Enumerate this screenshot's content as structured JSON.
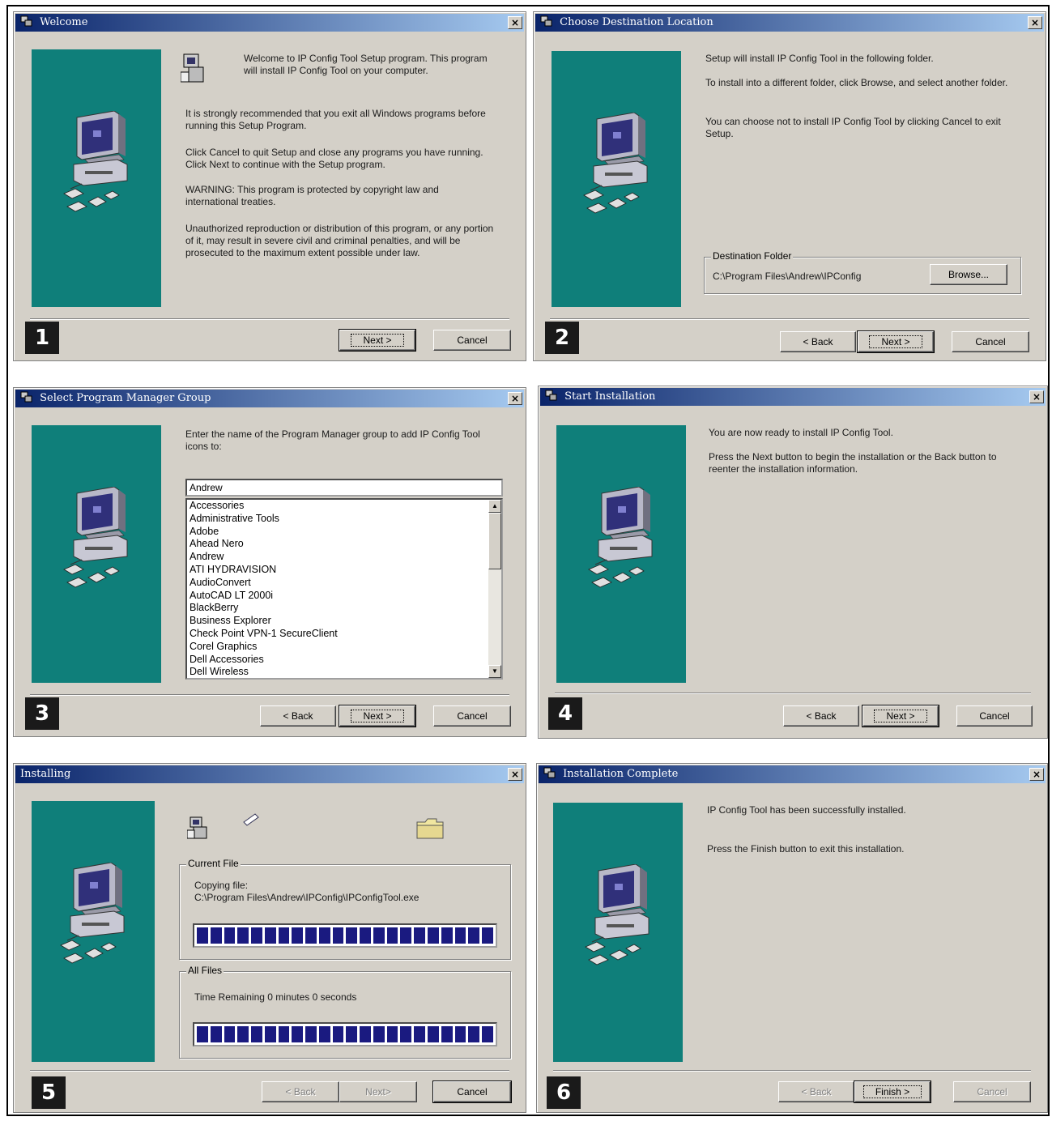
{
  "colors": {
    "teal": "#0f7f7a",
    "title_start": "#0a246a",
    "title_end": "#a6caf0",
    "progress": "#1a1a80",
    "face": "#d4d0c8"
  },
  "icons": {
    "title": "setup-icon",
    "close": "close-icon",
    "panel": "computer-with-disks-icon"
  },
  "d1": {
    "number": "1",
    "title": "Welcome",
    "intro": "Welcome to IP Config Tool Setup program. This program will install IP Config Tool on your computer.",
    "p1": "It is strongly recommended that you exit all Windows programs before running this Setup Program.",
    "p2": "Click Cancel to quit Setup and close any programs you have running. Click Next to continue with the Setup program.",
    "p3": "WARNING: This program is protected by copyright law and international treaties.",
    "p4": "Unauthorized reproduction or distribution of this program, or any portion of it, may result in severe civil and criminal penalties, and will be prosecuted to the maximum extent possible under law.",
    "next": "Next >",
    "cancel": "Cancel"
  },
  "d2": {
    "number": "2",
    "title": "Choose Destination Location",
    "p1": "Setup will install IP Config Tool in the following folder.",
    "p2": "To install into a different folder, click Browse, and select another folder.",
    "p3": "You can choose not to install IP Config Tool by clicking Cancel to exit Setup.",
    "group_label": "Destination Folder",
    "path": "C:\\Program Files\\Andrew\\IPConfig",
    "browse": "Browse...",
    "back": "< Back",
    "next": "Next >",
    "cancel": "Cancel"
  },
  "d3": {
    "number": "3",
    "title": "Select Program Manager Group",
    "prompt": "Enter the name of the Program Manager group to add IP Config Tool icons to:",
    "value": "Andrew",
    "items": [
      "Accessories",
      "Administrative Tools",
      "Adobe",
      "Ahead Nero",
      "Andrew",
      "ATI HYDRAVISION",
      "AudioConvert",
      "AutoCAD LT 2000i",
      "BlackBerry",
      "Business Explorer",
      "Check Point VPN-1 SecureClient",
      "Corel Graphics",
      "Dell Accessories",
      "Dell Wireless"
    ],
    "back": "< Back",
    "next": "Next >",
    "cancel": "Cancel"
  },
  "d4": {
    "number": "4",
    "title": "Start Installation",
    "p1": "You are now ready to install IP Config Tool.",
    "p2": "Press the Next button to begin the installation or the Back button to reenter the installation information.",
    "back": "< Back",
    "next": "Next >",
    "cancel": "Cancel"
  },
  "d5": {
    "number": "5",
    "title": "Installing",
    "group1": "Current File",
    "copying": "Copying file:",
    "file": "C:\\Program Files\\Andrew\\IPConfig\\IPConfigTool.exe",
    "group2": "All Files",
    "time": "Time Remaining 0 minutes 0 seconds",
    "progress_file": 1.0,
    "progress_all": 1.0,
    "back": "< Back",
    "next": "Next>",
    "cancel": "Cancel"
  },
  "d6": {
    "number": "6",
    "title": "Installation Complete",
    "p1": "IP Config Tool has been successfully installed.",
    "p2": "Press the Finish button to exit this installation.",
    "back": "< Back",
    "finish": "Finish >",
    "cancel": "Cancel"
  }
}
